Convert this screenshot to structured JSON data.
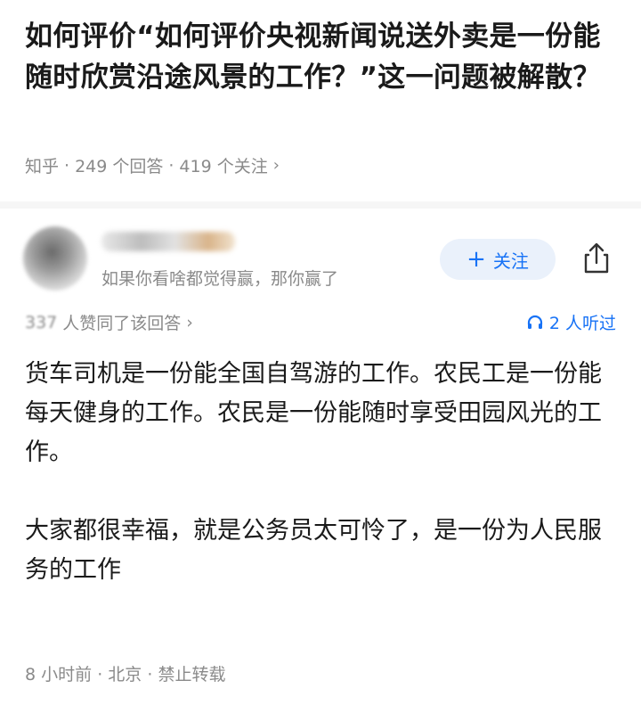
{
  "question": {
    "title": "如何评价“如何评价央视新闻说送外卖是一份能随时欣赏沿途风景的工作？”这一问题被解散？",
    "source": "知乎",
    "answer_count": "249 个回答",
    "follower_count": "419 个关注",
    "separator": "·",
    "more_chevron": "›"
  },
  "author": {
    "signature": "如果你看啥都觉得赢，那你赢了",
    "follow_label": "关注",
    "follow_plus": "+"
  },
  "stats": {
    "likes_number": "337",
    "likes_text": "人赞同了该回答",
    "likes_chevron": "›",
    "listen_text": "2 人听过"
  },
  "answer": {
    "paragraph1": "货车司机是一份能全国自驾游的工作。农民工是一份能每天健身的工作。农民是一份能随时享受田园风光的工作。",
    "paragraph2": "大家都很幸福，就是公务员太可怜了，是一份为人民服务的工作"
  },
  "footer": {
    "time": "8 小时前",
    "location": "北京",
    "copyright": "禁止转载",
    "separator": "·"
  },
  "colors": {
    "accent": "#1772f6",
    "muted": "#8a8a8a",
    "text": "#1a1a1a"
  }
}
